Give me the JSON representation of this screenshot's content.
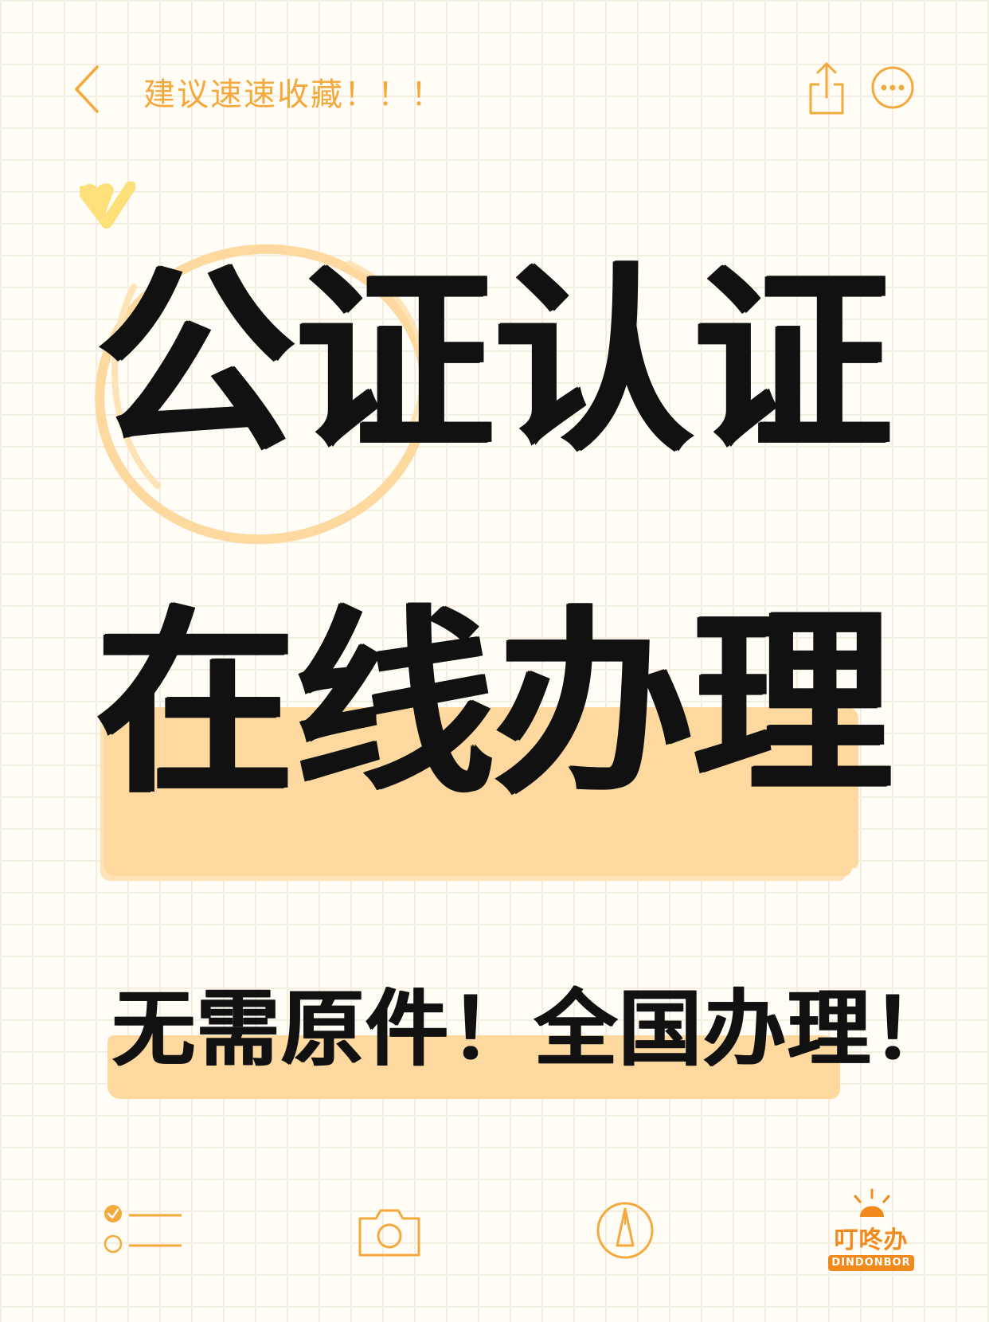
{
  "header": {
    "title": "建议速速收藏！！！",
    "back_icon": "chevron-left-icon",
    "share_icon": "share-icon",
    "more_icon": "more-icon"
  },
  "headline": {
    "line1": "公证认证",
    "line2": "在线办理"
  },
  "subline": "无需原件！全国办理！",
  "toolbar": {
    "checklist_icon": "checklist-icon",
    "camera_icon": "camera-icon",
    "pen_icon": "pen-icon"
  },
  "logo": {
    "name": "叮咚办",
    "subtitle": "DINDONBOR"
  },
  "colors": {
    "accent": "#f4a93c",
    "highlight": "#fdd9a0",
    "text": "#111111",
    "background": "#fffdf6",
    "logo": "#f08a1c"
  }
}
